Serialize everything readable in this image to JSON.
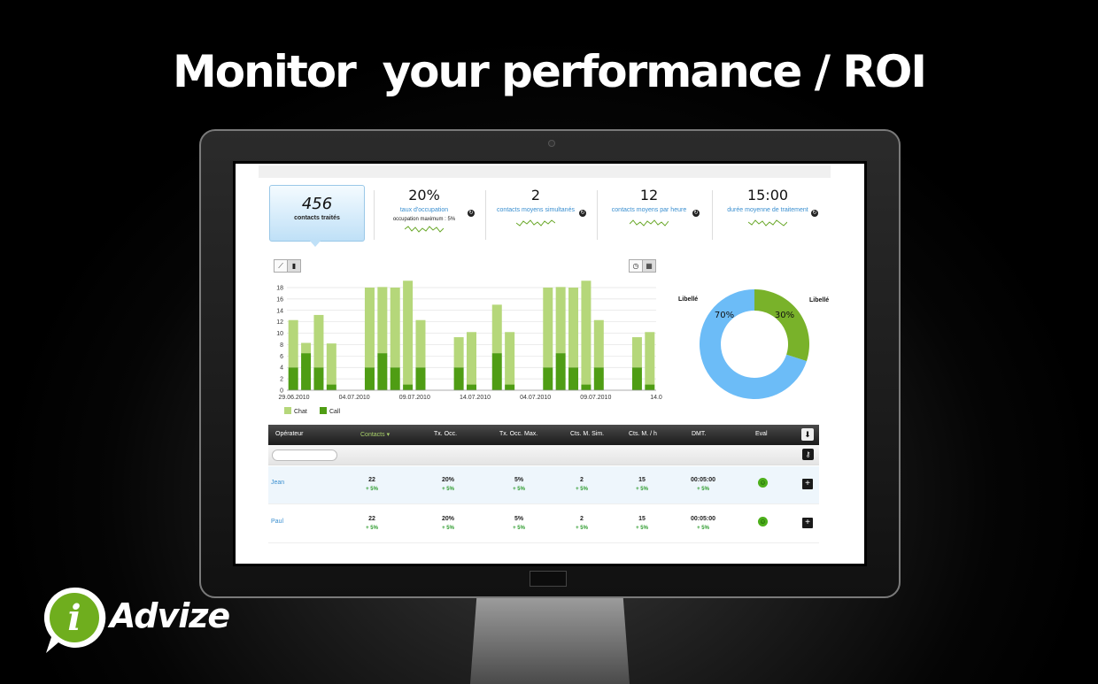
{
  "headline": "Monitor  your performance / ROI",
  "kpis": [
    {
      "value": "456",
      "label": "contacts traités",
      "active": true
    },
    {
      "value": "20%",
      "label": "taux d'occupation",
      "sub": "occupation maximum :  5%"
    },
    {
      "value": "2",
      "label": "contacts moyens simultanés"
    },
    {
      "value": "12",
      "label": "contacts moyens par heure"
    },
    {
      "value": "15:00",
      "label": "durée moyenne de traitement"
    }
  ],
  "chart_data": [
    {
      "type": "bar",
      "stacked": true,
      "y_ticks": [
        "0",
        "2",
        "4",
        "6",
        "8",
        "10",
        "12",
        "14",
        "16",
        "18"
      ],
      "ylim": [
        0,
        18
      ],
      "x_tick_labels": [
        "29.06.2010",
        "04.07.2010",
        "09.07.2010",
        "14.07.2010",
        "04.07.2010",
        "09.07.2010",
        "14.0"
      ],
      "series": [
        {
          "name": "Call",
          "color": "#4f9d14",
          "values": [
            4,
            6.5,
            4,
            1,
            0,
            0,
            4,
            6.5,
            4,
            1,
            4,
            0,
            0,
            4,
            1,
            0,
            6.5,
            1,
            0,
            0,
            4,
            6.5,
            4,
            1,
            4,
            0,
            0,
            4,
            1
          ]
        },
        {
          "name": "Chat",
          "color": "#b5d77a",
          "values": [
            8.3,
            1.8,
            9.2,
            7.2,
            0,
            0,
            14,
            11.6,
            14,
            18.2,
            8.3,
            0,
            0,
            5.3,
            9.2,
            0,
            8.5,
            9.2,
            0,
            0,
            14,
            11.6,
            14,
            18.2,
            8.3,
            0,
            0,
            5.3,
            9.2
          ]
        }
      ],
      "legend": [
        "Chat",
        "Call"
      ],
      "grid": true
    },
    {
      "type": "pie",
      "donut": true,
      "labels": [
        "Libellé",
        "Libellé"
      ],
      "values": [
        70,
        30
      ],
      "value_labels": [
        "70%",
        "30%"
      ],
      "colors": [
        "#6cbcf7",
        "#79b22a"
      ]
    }
  ],
  "table": {
    "headers": [
      "Opérateur",
      "Contacts ▾",
      "Tx. Occ.",
      "Tx. Occ. Max.",
      "Cts. M. Sim.",
      "Cts. M. / h",
      "DMT.",
      "Eval"
    ],
    "rows": [
      {
        "name": "Jean",
        "contacts": "22",
        "occ": "20%",
        "occmax": "5%",
        "sim": "2",
        "perh": "15",
        "dmt": "00:05:00",
        "delta": "+ 5%"
      },
      {
        "name": "Paul",
        "contacts": "22",
        "occ": "20%",
        "occmax": "5%",
        "sim": "2",
        "perh": "15",
        "dmt": "00:05:00",
        "delta": "+ 5%"
      }
    ]
  },
  "logo": {
    "text": "Advize",
    "mark": "i"
  }
}
